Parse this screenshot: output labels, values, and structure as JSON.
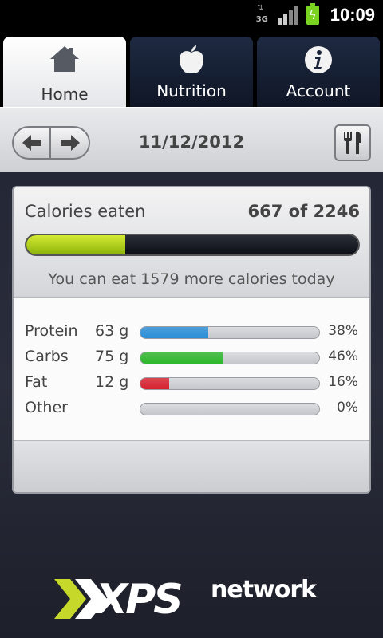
{
  "status_bar": {
    "network": "3G",
    "time": "10:09"
  },
  "tabs": [
    {
      "label": "Home",
      "icon": "home-icon",
      "active": true
    },
    {
      "label": "Nutrition",
      "icon": "apple-icon",
      "active": false
    },
    {
      "label": "Account",
      "icon": "info-icon",
      "active": false
    }
  ],
  "date_bar": {
    "date": "11/12/2012"
  },
  "calories": {
    "label": "Calories eaten",
    "value_text": "667 of 2246",
    "eaten": 667,
    "goal": 2246,
    "remaining_text": "You can eat 1579 more calories today"
  },
  "macros": [
    {
      "name": "Protein",
      "grams": "63 g",
      "percent": 38,
      "percent_text": "38%",
      "color": "#2a8fd8"
    },
    {
      "name": "Carbs",
      "grams": "75 g",
      "percent": 46,
      "percent_text": "46%",
      "color": "#2db82b"
    },
    {
      "name": "Fat",
      "grams": "12 g",
      "percent": 16,
      "percent_text": "16%",
      "color": "#d8222f"
    },
    {
      "name": "Other",
      "grams": "",
      "percent": 0,
      "percent_text": "0%",
      "color": "#999999"
    }
  ],
  "logo": {
    "mark": "XPS",
    "text": "network",
    "accent_color": "#c6d82a"
  }
}
